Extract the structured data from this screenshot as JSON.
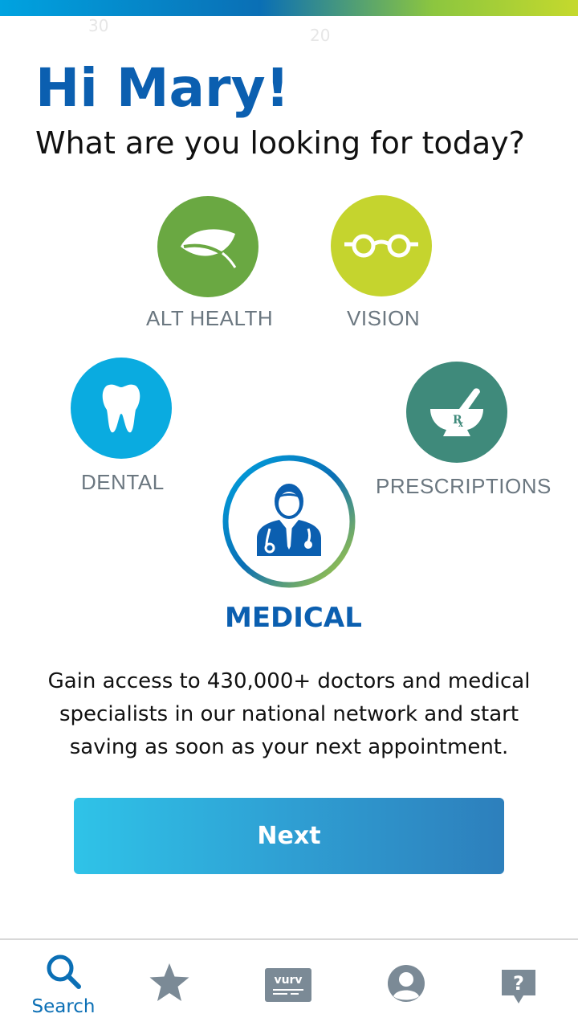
{
  "greeting": "Hi Mary!",
  "question": "What are you looking for today?",
  "categories": {
    "alt_health": "ALT HEALTH",
    "vision": "VISION",
    "dental": "DENTAL",
    "prescriptions": "PRESCRIPTIONS",
    "medical": "MEDICAL"
  },
  "description": "Gain access to 430,000+ doctors and medical specialists in our national network and start saving as soon as your next appointment.",
  "next_label": "Next",
  "tabbar": {
    "search_label": "Search",
    "active_tab": "search"
  },
  "colors": {
    "brand_blue": "#0b5fb0",
    "alt_health": "#6aa842",
    "vision": "#c5d42e",
    "dental": "#0aabe0",
    "prescriptions": "#3f8a7b",
    "icon_gray": "#7b8a96"
  },
  "icons": {
    "alt_health": "leaf-icon",
    "vision": "glasses-icon",
    "dental": "tooth-icon",
    "prescriptions": "mortar-pestle-icon",
    "medical": "doctor-icon"
  }
}
